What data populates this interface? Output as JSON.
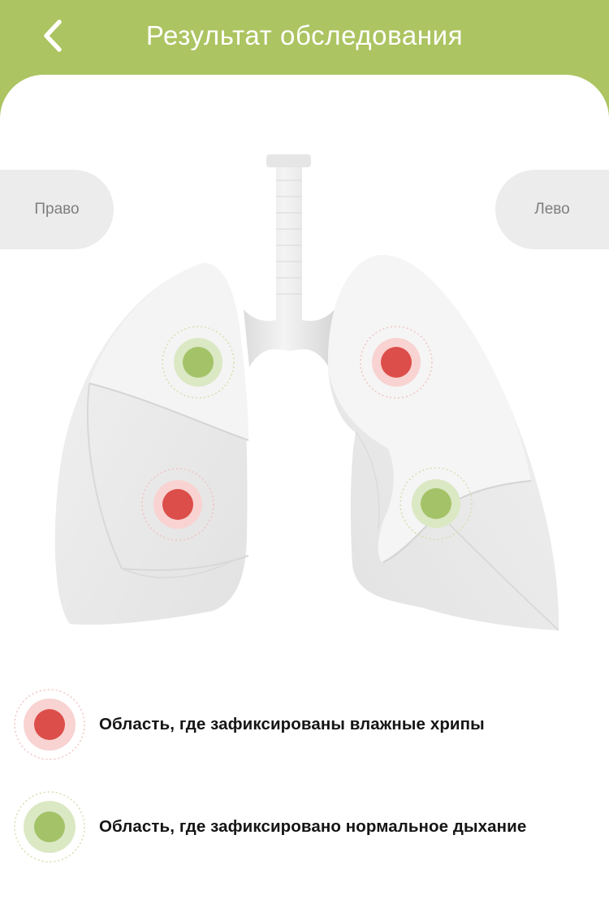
{
  "header": {
    "title": "Результат обследования",
    "back_icon": "chevron-left-icon"
  },
  "sides": {
    "right_label": "Право",
    "left_label": "Лево"
  },
  "colors": {
    "header_bg": "#acc461",
    "crackles": "#dc4e4a",
    "normal": "#a4c268",
    "lung": "#e9e9e9"
  },
  "markers": [
    {
      "id": "upper-right-lobe",
      "status": "normal"
    },
    {
      "id": "lower-right-lobe",
      "status": "crackles"
    },
    {
      "id": "upper-left-lobe",
      "status": "crackles"
    },
    {
      "id": "lower-left-lobe",
      "status": "normal"
    }
  ],
  "legend": [
    {
      "status": "crackles",
      "label": "Область, где зафиксированы влажные хрипы"
    },
    {
      "status": "normal",
      "label": "Область, где зафиксировано нормальное дыхание"
    }
  ]
}
